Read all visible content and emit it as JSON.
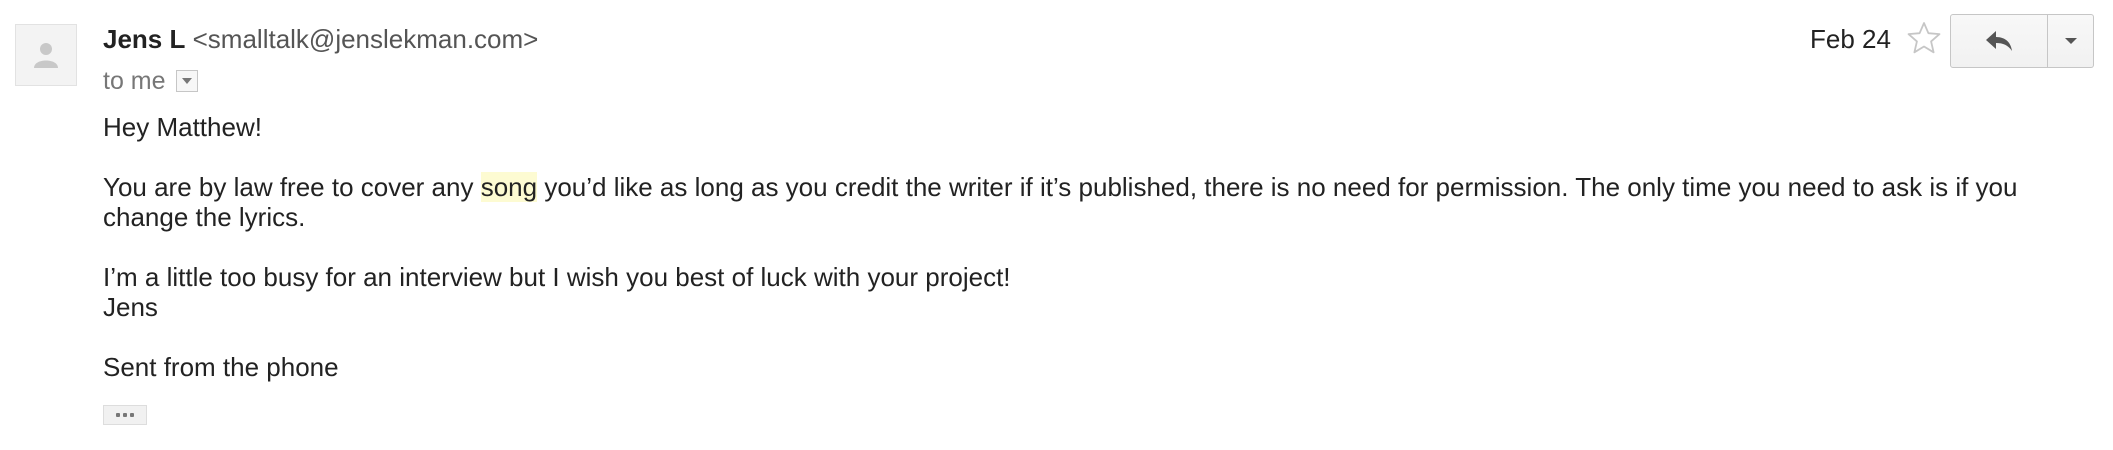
{
  "email": {
    "sender_name": "Jens L",
    "sender_email": "<smalltalk@jenslekman.com>",
    "recipient": "to me",
    "date": "Feb 24",
    "greeting": "Hey Matthew!",
    "paragraph_before_highlight": "You are by law free to cover any ",
    "highlighted_word": "song",
    "paragraph_after_highlight": " you’d like as long as you credit the writer if it’s published, there is no need for permission. The only time you need to ask is if you change the lyrics.",
    "line_busy": "I’m a little too busy for an interview but I wish you best of luck with your project!",
    "signature": "Jens",
    "sent_from": "Sent from the phone"
  },
  "icons": {
    "avatar": "person-icon",
    "star": "star-icon",
    "reply": "reply-icon",
    "more": "chevron-down-icon",
    "recipient_dropdown": "dropdown-icon",
    "ellipsis": "ellipsis-icon"
  },
  "colors": {
    "highlight": "#fdfbd2",
    "muted_text": "#777777",
    "border": "#c6c6c6"
  }
}
